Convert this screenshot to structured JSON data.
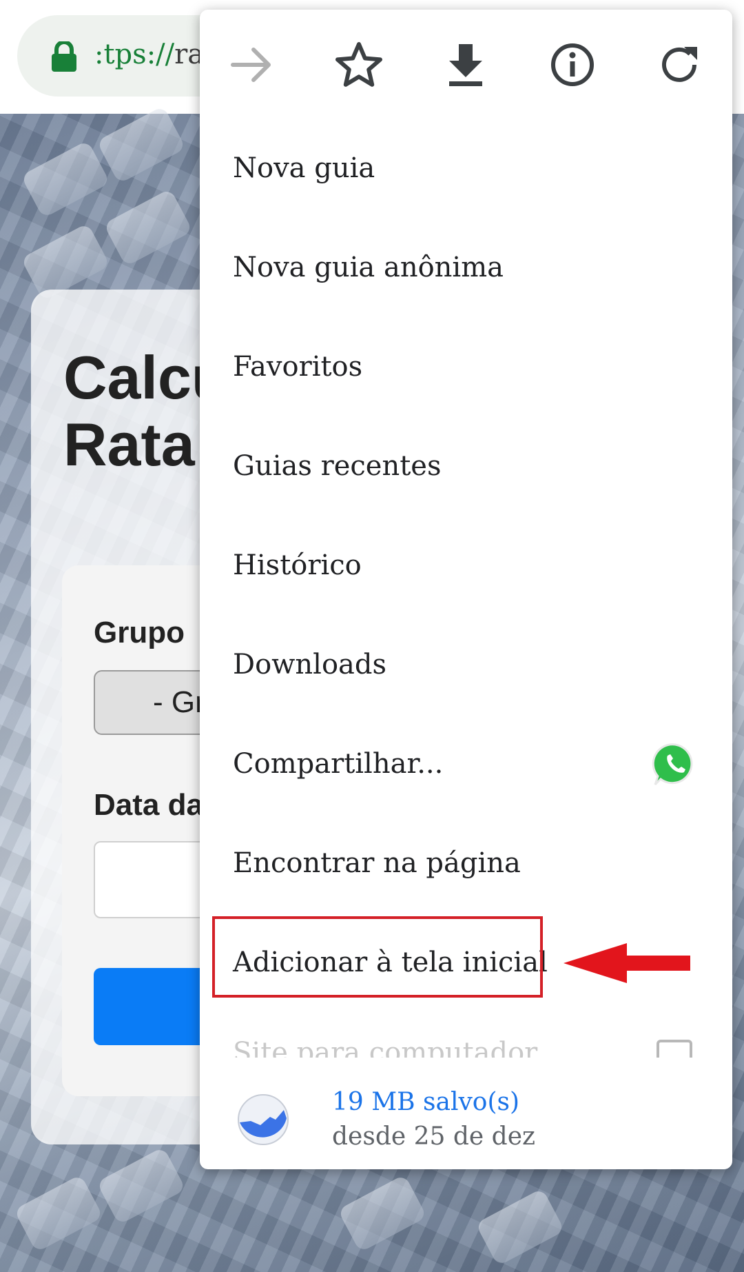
{
  "browser": {
    "url_scheme_fragment": "tps://",
    "url_host_fragment": "ra",
    "url_prefix": ":"
  },
  "page": {
    "title_line1": "Calcu",
    "title_line2": "Rata",
    "field_group_label": "Grupo",
    "field_group_value": "- Gr",
    "field_date_label": "Data da"
  },
  "menu": {
    "toolbar": {
      "forward_icon": "arrow-right-icon",
      "bookmark_icon": "star-icon",
      "download_icon": "download-icon",
      "info_icon": "info-icon",
      "refresh_icon": "refresh-icon"
    },
    "items": [
      {
        "label": "Nova guia"
      },
      {
        "label": "Nova guia anônima"
      },
      {
        "label": "Favoritos"
      },
      {
        "label": "Guias recentes"
      },
      {
        "label": "Histórico"
      },
      {
        "label": "Downloads"
      },
      {
        "label": "Compartilhar..."
      },
      {
        "label": "Encontrar na página"
      },
      {
        "label": "Adicionar à tela inicial"
      }
    ],
    "faded_item_label": "Site para computador",
    "data_saver": {
      "line1": "19 MB salvo(s)",
      "line2": "desde 25 de dez"
    }
  },
  "colors": {
    "accent_blue": "#1a73e8",
    "annotation_red": "#d42027",
    "lock_green": "#188038"
  }
}
